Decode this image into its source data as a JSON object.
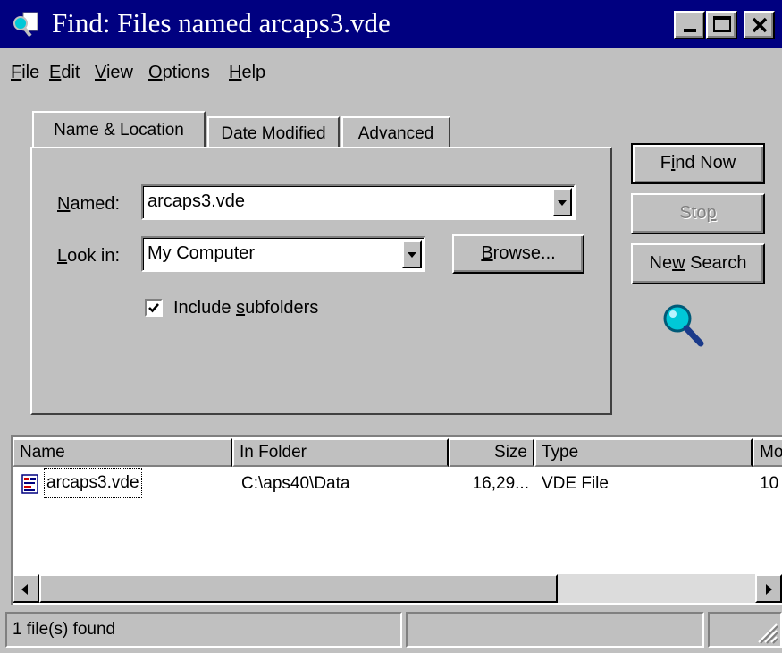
{
  "window": {
    "title": "Find: Files named arcaps3.vde"
  },
  "menu": [
    {
      "label": "File",
      "hotkey": "F",
      "rest": "ile"
    },
    {
      "label": "Edit",
      "hotkey": "E",
      "rest": "dit"
    },
    {
      "label": "View",
      "hotkey": "V",
      "rest": "iew"
    },
    {
      "label": "Options",
      "hotkey": "O",
      "rest": "ptions"
    },
    {
      "label": "Help",
      "hotkey": "H",
      "rest": "elp"
    }
  ],
  "tabs": {
    "name_location": "Name & Location",
    "date_modified": "Date Modified",
    "advanced": "Advanced"
  },
  "form": {
    "named_label_hotkey": "N",
    "named_label_rest": "amed:",
    "named_value": "arcaps3.vde",
    "lookin_label_hotkey": "L",
    "lookin_label_rest": "ook in:",
    "lookin_value": "My Computer",
    "include_subfolders_pre": "Include ",
    "include_subfolders_hotkey": "s",
    "include_subfolders_post": "ubfolders",
    "include_subfolders_checked": true,
    "browse_hotkey": "B",
    "browse_rest": "rowse..."
  },
  "buttons": {
    "find_now_pre": "F",
    "find_now_hotkey": "i",
    "find_now_post": "nd Now",
    "stop_pre": "Sto",
    "stop_hotkey": "p",
    "new_search_pre": "Ne",
    "new_search_hotkey": "w",
    "new_search_post": " Search"
  },
  "results": {
    "columns": [
      "Name",
      "In Folder",
      "Size",
      "Type",
      "Mo"
    ],
    "rows": [
      {
        "name": "arcaps3.vde",
        "folder": "C:\\aps40\\Data",
        "size": "16,29...",
        "type": "VDE File",
        "modified": "10"
      }
    ]
  },
  "status": {
    "text": "1 file(s) found"
  },
  "colors": {
    "titlebar": "#000080",
    "face": "#c0c0c0",
    "magnifier": "#00c8d8"
  }
}
